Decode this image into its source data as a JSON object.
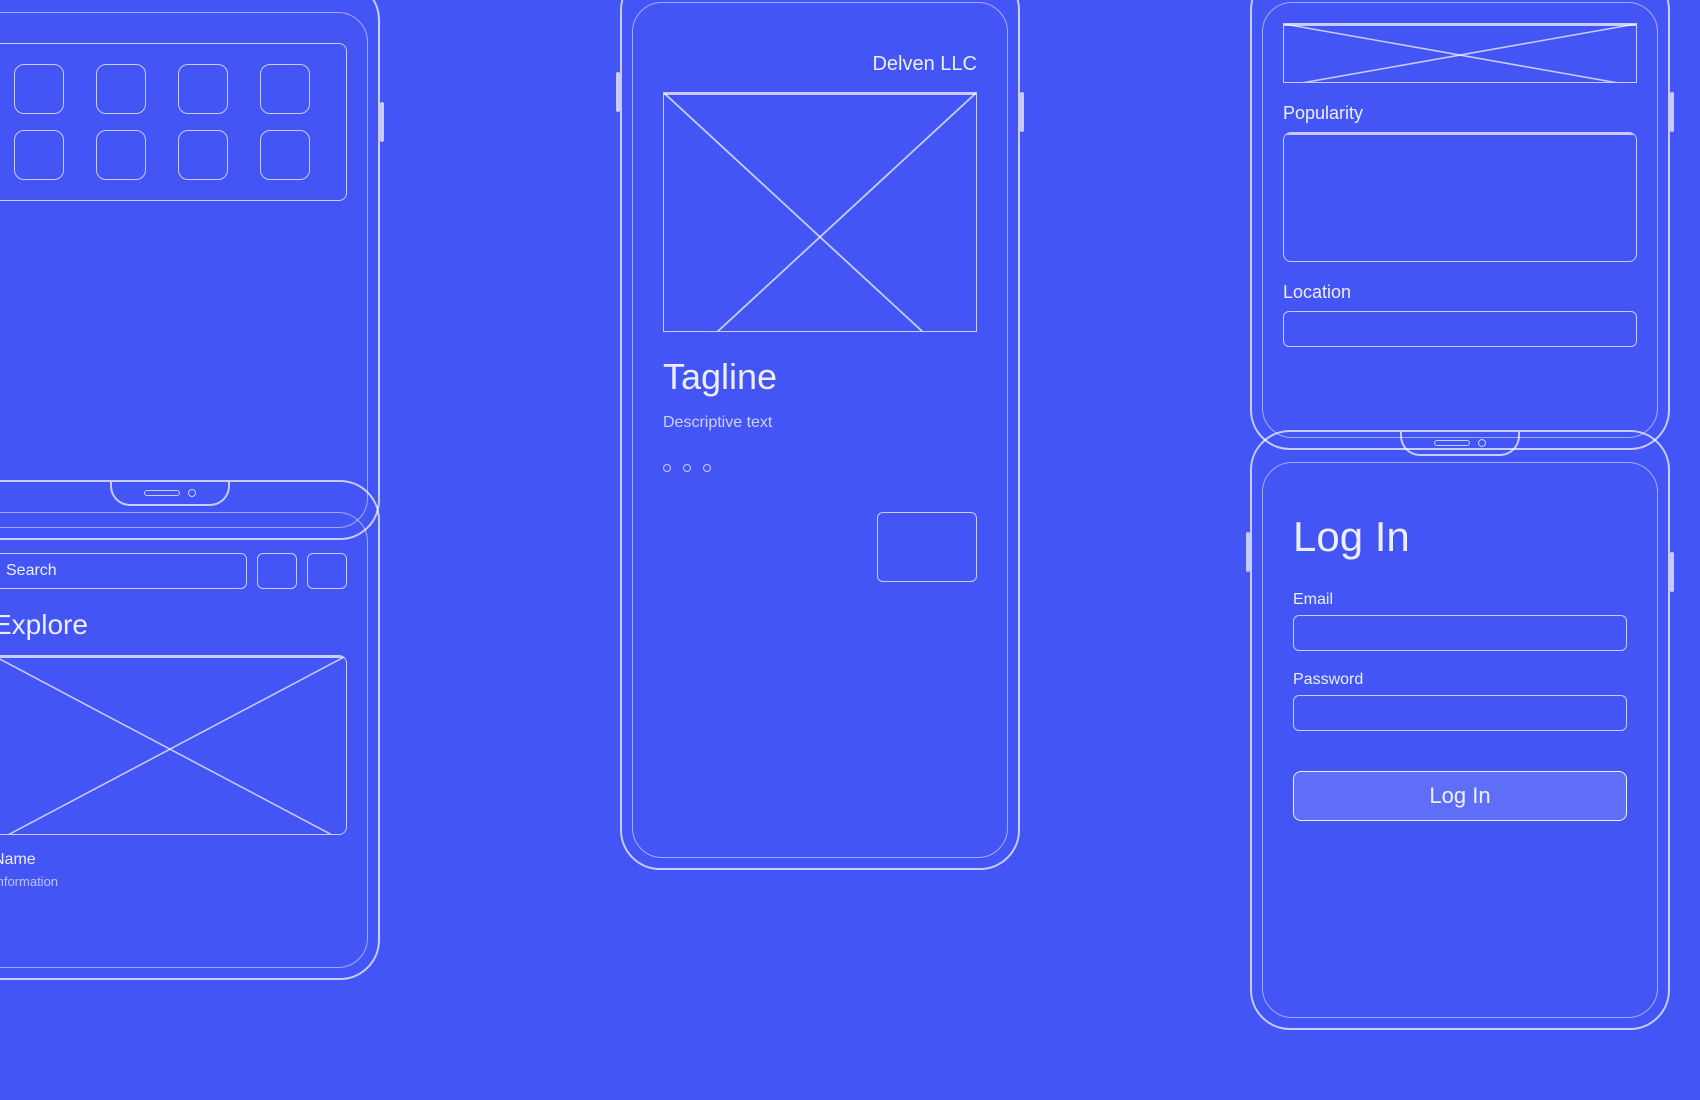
{
  "background": "#4455f5",
  "phones": {
    "topleft": {
      "label": "grid-apps-phone",
      "grid_rows": 2,
      "grid_cols": 4
    },
    "center": {
      "label": "hero-phone",
      "company": "Delven LLC",
      "tagline": "Tagline",
      "descriptive_text": "Descriptive text",
      "dots_count": 3
    },
    "topright": {
      "label": "filter-phone",
      "popularity_label": "Popularity",
      "location_label": "Location"
    },
    "bottomleft": {
      "label": "search-phone",
      "search_placeholder": "Search",
      "explore_label": "Explore",
      "name_label": "Name",
      "info_label": "Information"
    },
    "bottomright": {
      "label": "login-phone",
      "title": "Log In",
      "email_label": "Email",
      "password_label": "Password",
      "button_label": "Log In"
    }
  }
}
